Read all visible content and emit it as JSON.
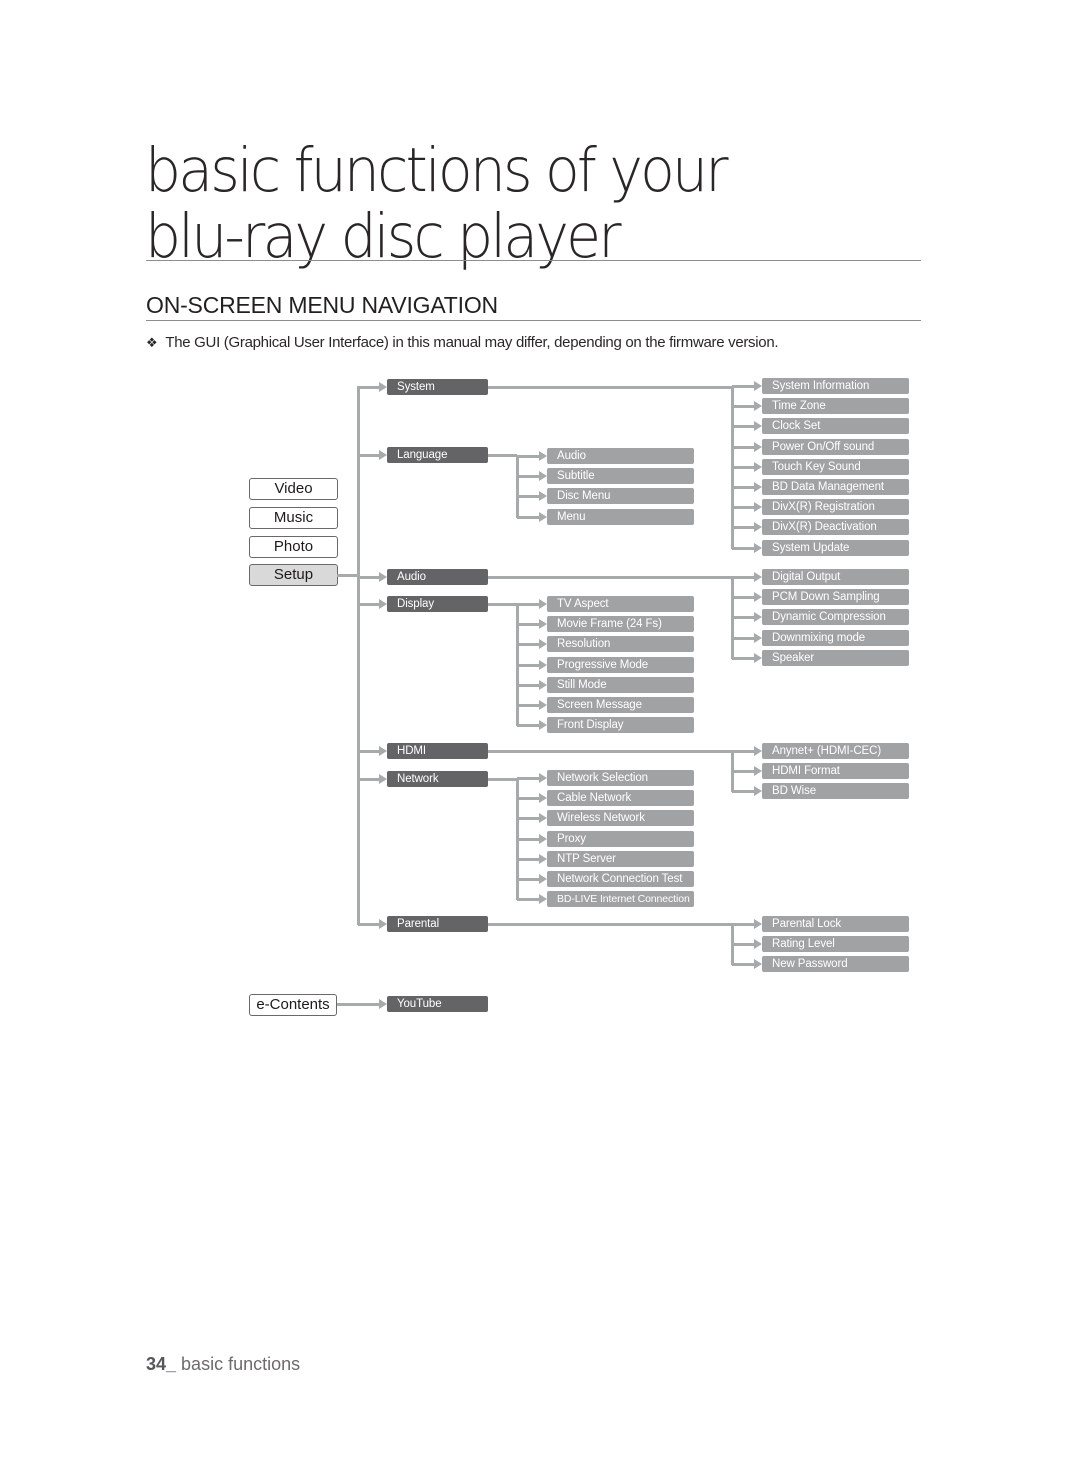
{
  "page": {
    "chapter_title_line1": "basic functions of your",
    "chapter_title_line2": "blu-ray disc player",
    "section_title": "ON-SCREEN MENU NAVIGATION",
    "note_bullet": "❖",
    "note_text": "The GUI (Graphical User Interface) in this manual may differ, depending on the firmware version.",
    "footer_number": "34_",
    "footer_text": " basic functions"
  },
  "menu": {
    "root_items": [
      {
        "label": "Video",
        "active": false
      },
      {
        "label": "Music",
        "active": false
      },
      {
        "label": "Photo",
        "active": false
      },
      {
        "label": "Setup",
        "active": true
      },
      {
        "label": "e-Contents",
        "active": false
      }
    ],
    "setup": [
      {
        "label": "System",
        "children": [
          "System Information",
          "Time Zone",
          "Clock Set",
          "Power On/Off sound",
          "Touch Key Sound",
          "BD Data Management",
          "DivX(R) Registration",
          "DivX(R) Deactivation",
          "System Update"
        ]
      },
      {
        "label": "Language",
        "children": [
          "Audio",
          "Subtitle",
          "Disc Menu",
          "Menu"
        ]
      },
      {
        "label": "Audio",
        "children": [
          "Digital Output",
          "PCM Down Sampling",
          "Dynamic Compression",
          "Downmixing mode",
          "Speaker"
        ]
      },
      {
        "label": "Display",
        "children": [
          "TV Aspect",
          "Movie Frame (24 Fs)",
          "Resolution",
          "Progressive Mode",
          "Still Mode",
          "Screen Message",
          "Front Display"
        ]
      },
      {
        "label": "HDMI",
        "children": [
          "Anynet+ (HDMI-CEC)",
          "HDMI Format",
          "BD Wise"
        ]
      },
      {
        "label": "Network",
        "children": [
          "Network Selection",
          "Cable Network",
          "Wireless Network",
          "Proxy",
          "NTP Server",
          "Network Connection Test",
          "BD-LIVE Internet Connection"
        ]
      },
      {
        "label": "Parental",
        "children": [
          "Parental Lock",
          "Rating Level",
          "New Password"
        ]
      }
    ],
    "econtents": [
      {
        "label": "YouTube"
      }
    ]
  },
  "colors": {
    "level1_box": "#646466",
    "level2_box": "#a1a2a4",
    "connector": "#a7aaaa",
    "active_root": "#d9d9d9"
  }
}
